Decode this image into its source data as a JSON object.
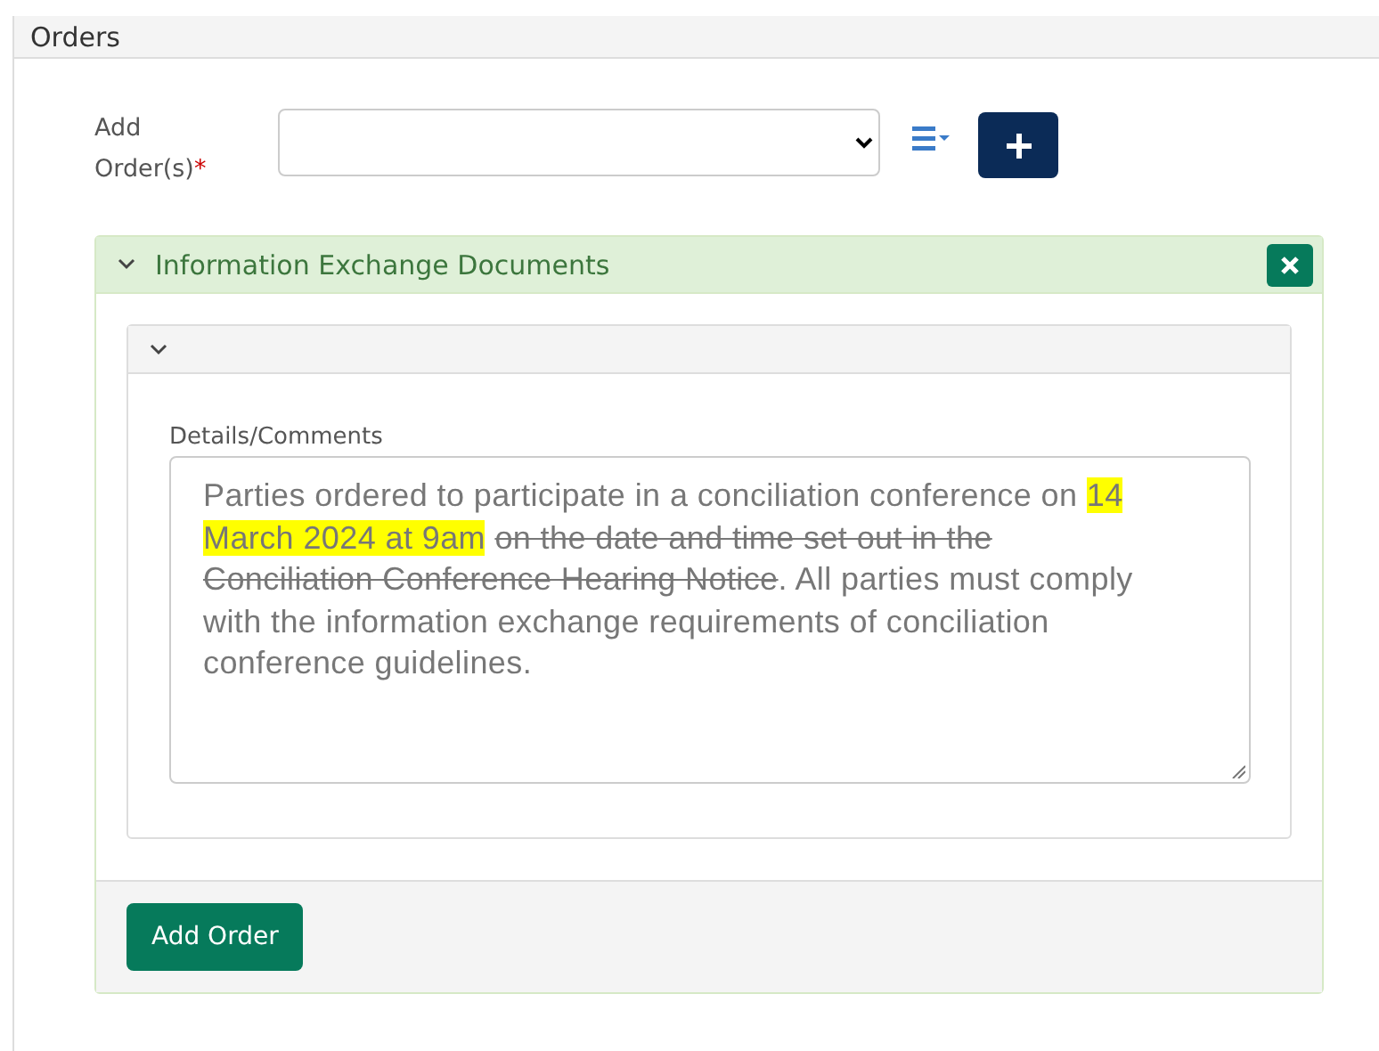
{
  "panel": {
    "title": "Orders"
  },
  "add_orders": {
    "label": "Add Order(s)",
    "required_mark": "*"
  },
  "section": {
    "title": "Information Exchange Documents",
    "expanded": true,
    "subsection": {
      "expanded": true
    },
    "details": {
      "label": "Details/Comments",
      "segments": [
        {
          "kind": "plain",
          "text": "Parties ordered to participate in a conciliation conference on "
        },
        {
          "kind": "highlight",
          "text": "14 March 2024 at 9am"
        },
        {
          "kind": "strike",
          "text": " on the date and time set out in the Conciliation Conference Hearing Notice"
        },
        {
          "kind": "plain",
          "text": ". All parties must comply with the information exchange requirements of conciliation conference guidelines."
        }
      ]
    },
    "button": "Add Order"
  }
}
